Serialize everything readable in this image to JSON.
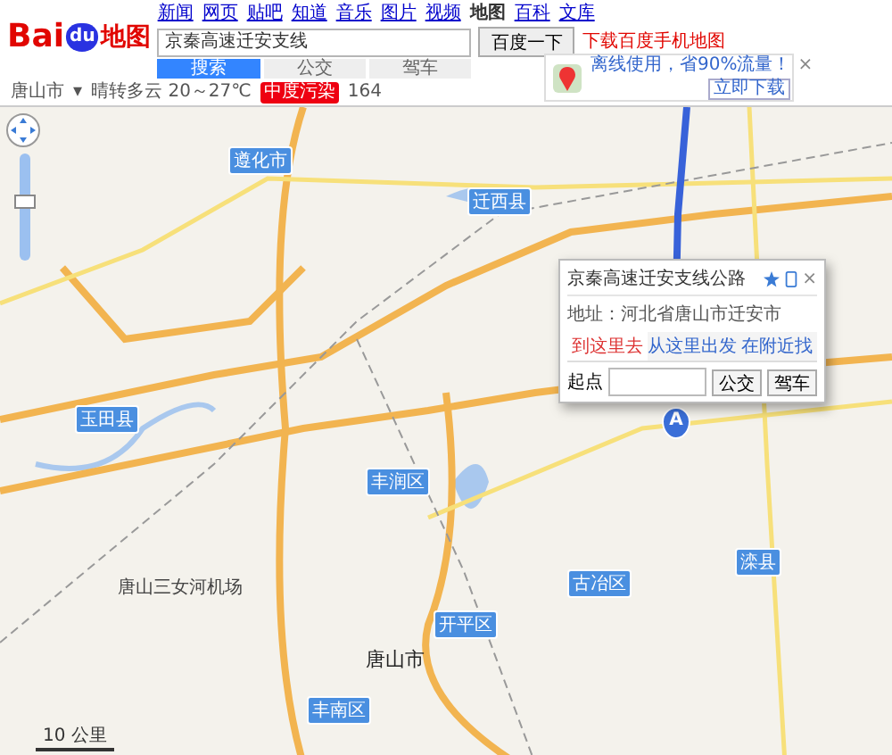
{
  "header": {
    "logo": {
      "text": "Bai",
      "paw": "du",
      "suffix": "地图"
    },
    "nav": [
      {
        "label": "新闻",
        "selected": false
      },
      {
        "label": "网页",
        "selected": false
      },
      {
        "label": "贴吧",
        "selected": false
      },
      {
        "label": "知道",
        "selected": false
      },
      {
        "label": "音乐",
        "selected": false
      },
      {
        "label": "图片",
        "selected": false
      },
      {
        "label": "视频",
        "selected": false
      },
      {
        "label": "地图",
        "selected": true
      },
      {
        "label": "百科",
        "selected": false
      },
      {
        "label": "文库",
        "selected": false
      }
    ],
    "search": {
      "value": "京秦高速迁安支线",
      "button": "百度一下"
    },
    "download_link": "下载百度手机地图",
    "tabs": [
      {
        "label": "搜索",
        "selected": true
      },
      {
        "label": "公交",
        "selected": false
      },
      {
        "label": "驾车",
        "selected": false
      }
    ]
  },
  "status_bar": {
    "city": "唐山市",
    "city_caret": "▾",
    "weather": "晴转多云 20～27℃",
    "air_quality": "中度污染",
    "aqi": "164"
  },
  "promo": {
    "text": "离线使用，省90%流量！",
    "button": "立即下载",
    "close": "×"
  },
  "map": {
    "zoom": {
      "level": 0.55
    },
    "scale": "10 公里",
    "places": [
      {
        "name": "遵化市",
        "kind": "district"
      },
      {
        "name": "迁西县",
        "kind": "district"
      },
      {
        "name": "玉田县",
        "kind": "district"
      },
      {
        "name": "丰润区",
        "kind": "district"
      },
      {
        "name": "开平区",
        "kind": "district"
      },
      {
        "name": "丰南区",
        "kind": "district"
      },
      {
        "name": "古冶区",
        "kind": "district"
      },
      {
        "name": "滦县",
        "kind": "district"
      },
      {
        "name": "唐山市",
        "kind": "city"
      },
      {
        "name": "唐山三女河机场",
        "kind": "airport"
      }
    ],
    "marker": "A"
  },
  "info_window": {
    "title": "京秦高速迁安支线公路",
    "close": "×",
    "address": "地址：河北省唐山市迁安市",
    "tabs": [
      {
        "label": "到这里去",
        "selected": true
      },
      {
        "label": "从这里出发",
        "selected": false
      },
      {
        "label": "在附近找",
        "selected": false
      }
    ],
    "start_label": "起点",
    "buttons": [
      "公交",
      "驾车"
    ]
  }
}
